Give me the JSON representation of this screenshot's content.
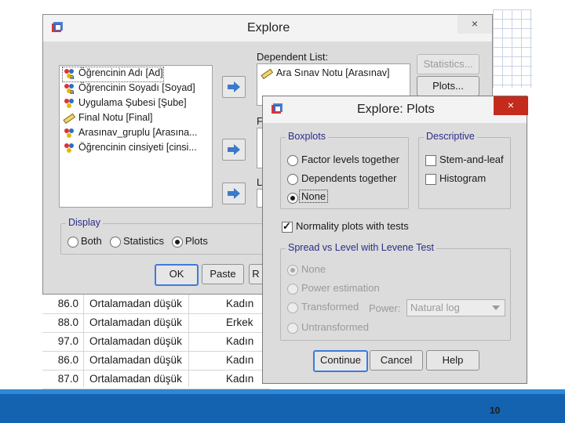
{
  "sheet": {
    "rows": [
      {
        "score": "86.0",
        "group": "Ortalamadan düşük",
        "gender": "Kadın"
      },
      {
        "score": "88.0",
        "group": "Ortalamadan düşük",
        "gender": "Erkek"
      },
      {
        "score": "97.0",
        "group": "Ortalamadan düşük",
        "gender": "Kadın"
      },
      {
        "score": "86.0",
        "group": "Ortalamadan düşük",
        "gender": "Kadın"
      },
      {
        "score": "87.0",
        "group": "Ortalamadan düşük",
        "gender": "Kadın"
      }
    ]
  },
  "explore": {
    "title": "Explore",
    "close": "×",
    "variables": [
      {
        "label": "Öğrencinin Adı [Ad]",
        "icon": "nominal-string-icon"
      },
      {
        "label": "Öğrencinin Soyadı [Soyad]",
        "icon": "nominal-string-icon"
      },
      {
        "label": "Uygulama Şubesi [Şube]",
        "icon": "nominal-icon"
      },
      {
        "label": "Final Notu [Final]",
        "icon": "scale-ruler-icon"
      },
      {
        "label": "Arasınav_gruplu [Arasına...",
        "icon": "nominal-icon"
      },
      {
        "label": "Öğrencinin cinsiyeti [cinsi...",
        "icon": "nominal-icon"
      }
    ],
    "dependent_label": "Dependent List:",
    "dependent_items": [
      "Ara Sınav Notu [Arasınav]"
    ],
    "factor_label": "F",
    "label_label": "L",
    "statistics_button": "Statistics...",
    "plots_button": "Plots...",
    "display_label": "Display",
    "display_options": [
      "Both",
      "Statistics",
      "Plots"
    ],
    "display_selected": "Plots",
    "ok_button": "OK",
    "paste_button": "Paste",
    "reset_button": "R"
  },
  "plots": {
    "title": "Explore: Plots",
    "close": "×",
    "boxplots_label": "Boxplots",
    "boxplots_options": [
      "Factor levels together",
      "Dependents together",
      "None"
    ],
    "boxplots_selected": "None",
    "descriptive_label": "Descriptive",
    "descriptive_options": [
      "Stem-and-leaf",
      "Histogram"
    ],
    "normality_label": "Normality plots with tests",
    "normality_checked": true,
    "spread_label": "Spread vs Level with Levene Test",
    "spread_options": [
      "None",
      "Power estimation",
      "Transformed",
      "Untransformed"
    ],
    "spread_selected": "None",
    "power_label": "Power:",
    "power_value": "Natural log",
    "continue_button": "Continue",
    "cancel_button": "Cancel",
    "help_button": "Help"
  },
  "footer": {
    "page_number": "10"
  },
  "colors": {
    "footer": "#1463b0",
    "accent_border": "#3d7bd9",
    "close_red": "#c42b1c",
    "group_label": "#2b2b8a"
  }
}
